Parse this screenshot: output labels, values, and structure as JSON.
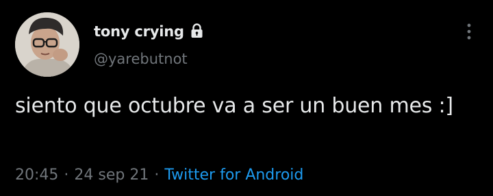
{
  "tweet": {
    "display_name": "tony crying",
    "handle": "@yarebutnot",
    "text": "siento que octubre va a ser un buen mes :]",
    "time": "20:45",
    "separator": "·",
    "date": "24 sep 21",
    "source": "Twitter for Android",
    "icons": {
      "lock": "lock-icon",
      "more": "more-options-icon"
    }
  },
  "colors": {
    "background": "#000000",
    "primary_text": "#e7e9ea",
    "secondary_text": "#71767b",
    "link": "#1d9bf0"
  }
}
